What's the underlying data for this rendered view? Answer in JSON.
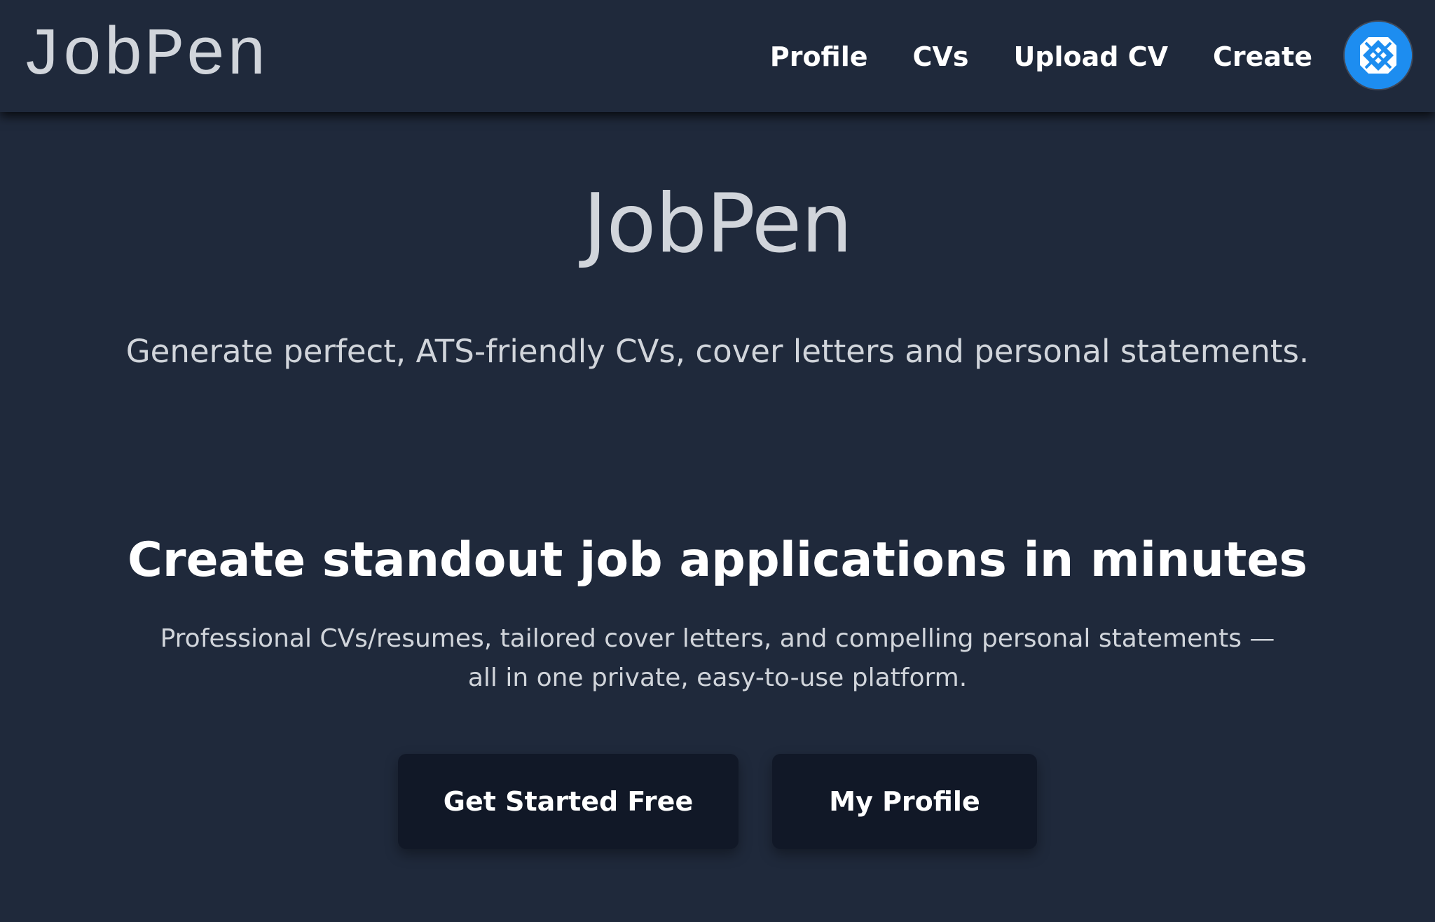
{
  "header": {
    "brand": "JobPen",
    "nav": [
      {
        "label": "Profile"
      },
      {
        "label": "CVs"
      },
      {
        "label": "Upload CV"
      },
      {
        "label": "Create"
      }
    ],
    "avatar_icon": "user-avatar-icon",
    "avatar_color": "#1d8df0"
  },
  "hero": {
    "title": "JobPen",
    "tagline": "Generate perfect, ATS-friendly CVs, cover letters and personal statements."
  },
  "features": {
    "heading": "Create standout job applications in minutes",
    "description": "Professional CVs/resumes, tailored cover letters, and compelling personal statements — all in one private, easy-to-use platform."
  },
  "actions": {
    "primary_label": "Get Started Free",
    "secondary_label": "My Profile"
  },
  "colors": {
    "background": "#1f293b",
    "button_background": "#111827",
    "accent": "#1d8df0"
  }
}
